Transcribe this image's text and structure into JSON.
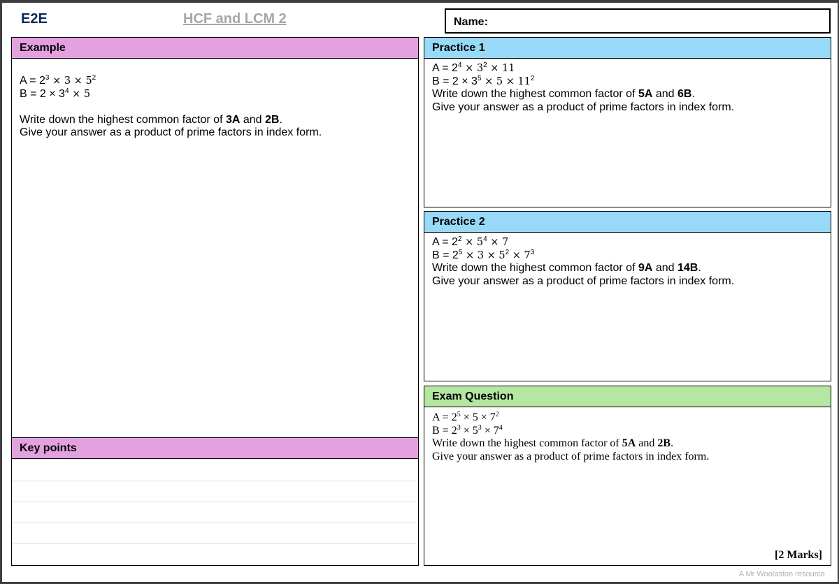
{
  "header": {
    "code": "E2E",
    "title": "HCF and LCM 2",
    "name_label": "Name:"
  },
  "example": {
    "heading": "Example",
    "line_a_prefix": "A = 2",
    "line_a_exp1": "3",
    "line_a_mid": " × 3 × 5",
    "line_a_exp2": "2",
    "line_b_prefix": "B = 2 × 3",
    "line_b_exp1": "4",
    "line_b_rest": " × 5",
    "q_text1": "Write down the highest common factor of ",
    "q_bold1": "3A",
    "q_and": " and ",
    "q_bold2": "2B",
    "q_end": ".",
    "q_text2": "Give your answer as a product of prime factors in index form."
  },
  "key_points": {
    "heading": "Key points"
  },
  "practice1": {
    "heading": "Practice 1",
    "a_prefix": "A = 2",
    "a_exp1": "4",
    "a_mid": " × 3",
    "a_exp2": "2",
    "a_rest": " × 11",
    "b_prefix": "B = 2 × 3",
    "b_exp1": "5",
    "b_mid": " × 5 × 11",
    "b_exp2": "2",
    "q_text1": "Write down the highest common factor of ",
    "q_bold1": "5A",
    "q_and": " and ",
    "q_bold2": "6B",
    "q_end": ".",
    "q_text2": "Give your answer as a product of prime factors in index form."
  },
  "practice2": {
    "heading": "Practice 2",
    "a_prefix": "A = 2",
    "a_exp1": "2",
    "a_mid": " × 5",
    "a_exp2": "4",
    "a_rest": " × 7",
    "b_prefix": "B = 2",
    "b_exp1": "5",
    "b_mid": " × 3 × 5",
    "b_exp2": "2",
    "b_mid2": " × 7",
    "b_exp3": "3",
    "q_text1": "Write down the highest common factor of ",
    "q_bold1": "9A",
    "q_and": " and ",
    "q_bold2": "14B",
    "q_end": ".",
    "q_text2": "Give your answer as a product of prime factors in index form."
  },
  "exam": {
    "heading": "Exam Question",
    "a_prefix": "A = 2",
    "a_exp1": "5",
    "a_mid": " × 5 × 7",
    "a_exp2": "2",
    "b_prefix": "B = 2",
    "b_exp1": "3",
    "b_mid": " × 5",
    "b_exp2": "3",
    "b_mid2": " × 7",
    "b_exp3": "4",
    "q_text1": "Write down the highest common factor of ",
    "q_bold1": "5A",
    "q_and": " and ",
    "q_bold2": "2B",
    "q_end": ".",
    "q_text2": "Give your answer as a product of prime factors in index form.",
    "marks": "[2 Marks]"
  },
  "footer": {
    "credit": "A Mr Woolaston resource"
  },
  "colors": {
    "example_header": "#e4a1df",
    "practice_header": "#97d9f6",
    "exam_header": "#b5e6a2",
    "code_text": "#0b2a5c",
    "title_text": "#a6a6a6"
  }
}
